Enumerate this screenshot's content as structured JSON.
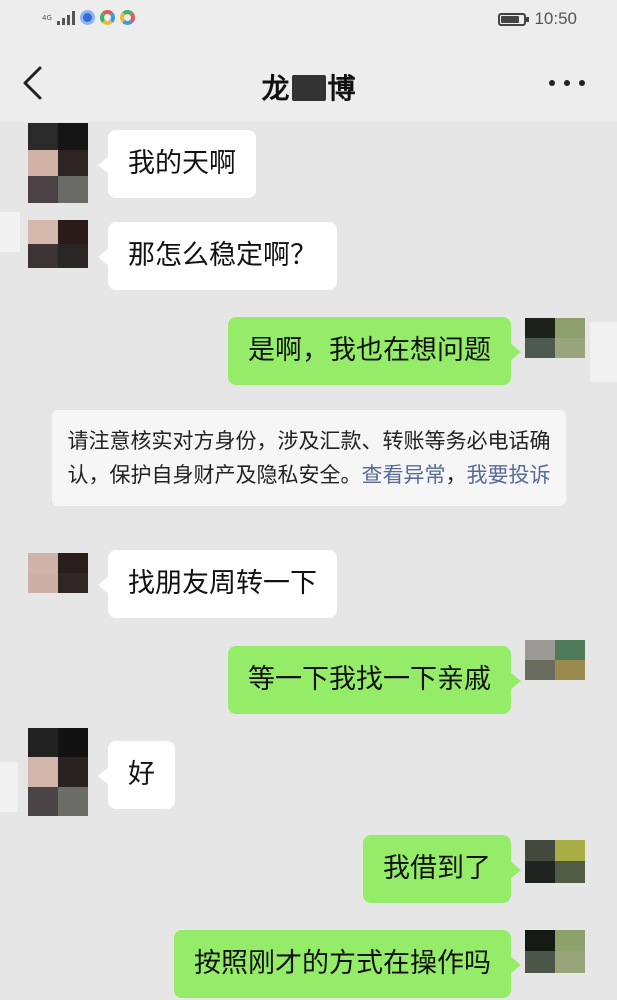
{
  "status_bar": {
    "network": "4G",
    "time": "10:50",
    "battery_level": 0.8,
    "icons": [
      "signal-icon",
      "app-icon-blue",
      "app-icon-colorful",
      "app-icon-colorful"
    ]
  },
  "header": {
    "title_left": "龙",
    "title_right": "博",
    "back_icon": "chevron-left-icon",
    "more_icon": "more-dots-icon"
  },
  "colors": {
    "chat_background": "#e6e6e6",
    "incoming_bubble": "#ffffff",
    "outgoing_bubble": "#95ec69",
    "link": "#576b95"
  },
  "messages": [
    {
      "direction": "in",
      "text": "我的天啊"
    },
    {
      "direction": "in",
      "text": "那怎么稳定啊？"
    },
    {
      "direction": "out",
      "text": "是啊，我也在想问题"
    },
    {
      "direction": "in",
      "text": "找朋友周转一下"
    },
    {
      "direction": "out",
      "text": "等一下我找一下亲戚"
    },
    {
      "direction": "in",
      "text": "好"
    },
    {
      "direction": "out",
      "text": "我借到了"
    },
    {
      "direction": "out",
      "text": "按照刚才的方式在操作吗"
    }
  ],
  "notice": {
    "text": "请注意核实对方身份，涉及汇款、转账等务必电话确认，保护自身财产及隐私安全。",
    "link_view": "查看异常",
    "separator": "，",
    "link_report": "我要投诉"
  }
}
